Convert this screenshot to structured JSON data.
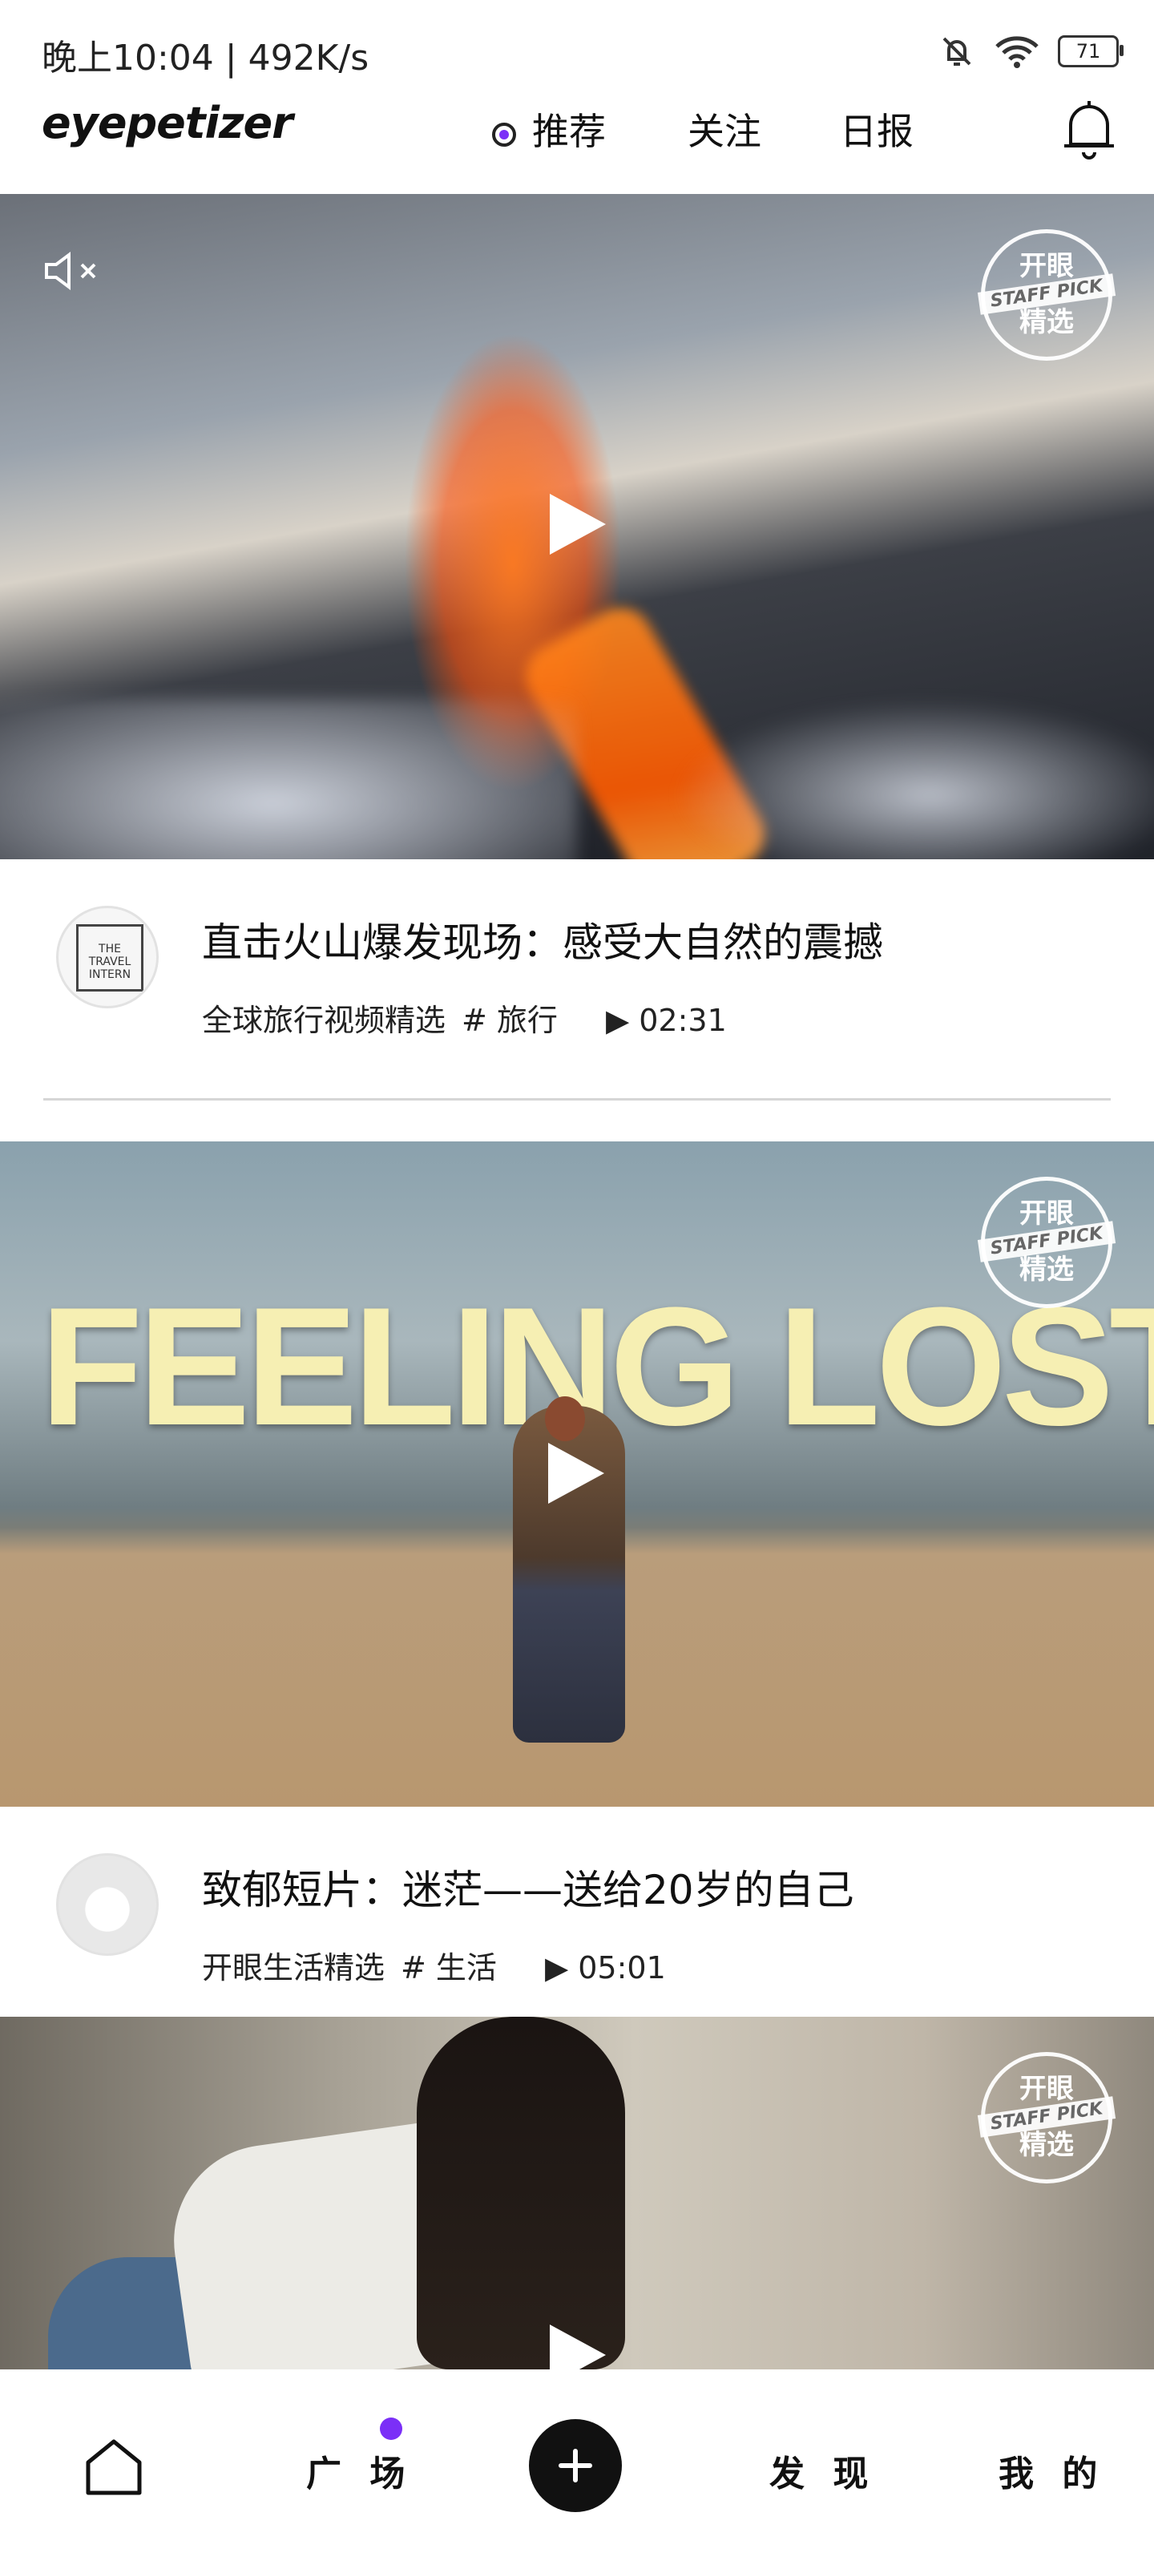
{
  "status_bar": {
    "time": "晚上10:04 | 492K/s",
    "battery": "71",
    "icons": [
      "mute-bell-icon",
      "wifi-icon",
      "battery-icon"
    ]
  },
  "header": {
    "logo": "eyepetizer",
    "tabs": [
      {
        "label": "推荐",
        "active": true
      },
      {
        "label": "关注",
        "active": false
      },
      {
        "label": "日报",
        "active": false
      }
    ],
    "accent": "#7b2ff7"
  },
  "feed": [
    {
      "badge_top": "开眼",
      "badge_mid": "STAFF PICK",
      "badge_bottom": "精选",
      "title": "直击火山爆发现场：感受大自然的震撼",
      "author": "全球旅行视频精选",
      "tag": "# 旅行",
      "duration": "▶ 02:31",
      "avatar_text": "THE TRAVEL INTERN"
    },
    {
      "overlay_text": "FEELING LOST?",
      "badge_top": "开眼",
      "badge_mid": "STAFF PICK",
      "badge_bottom": "精选",
      "title": "致郁短片：迷茫——送给20岁的自己",
      "author": "开眼生活精选",
      "tag": "# 生活",
      "duration": "▶ 05:01"
    },
    {
      "badge_top": "开眼",
      "badge_mid": "STAFF PICK",
      "badge_bottom": "精选"
    }
  ],
  "tabbar": {
    "items": [
      "广 场",
      "发 现",
      "我 的"
    ]
  }
}
